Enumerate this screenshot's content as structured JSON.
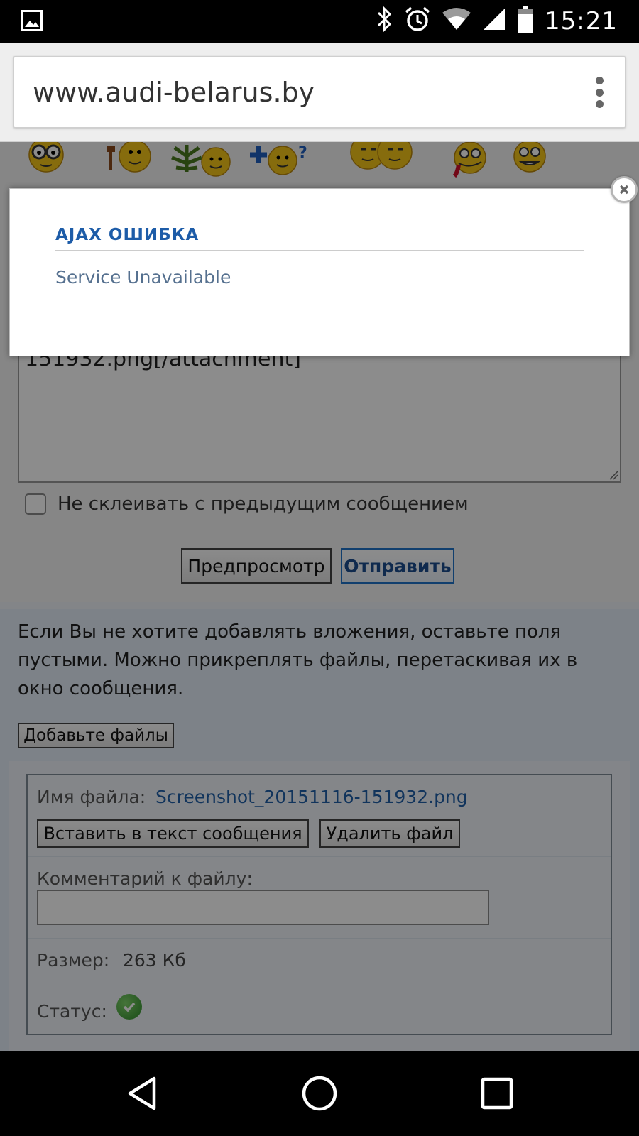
{
  "status_bar": {
    "time": "15:21",
    "icons": [
      "image-notification-icon",
      "bluetooth-icon",
      "alarm-icon",
      "wifi-icon",
      "cellular-signal-icon",
      "battery-icon"
    ]
  },
  "browser": {
    "url": "www.audi-belarus.by",
    "menu_icon": "overflow-menu-icon"
  },
  "editor": {
    "message_text": "151932.png[/attachment]",
    "no_merge_label": "Не склеивать с предыдущим сообщением",
    "no_merge_checked": false,
    "preview_button": "Предпросмотр",
    "submit_button": "Отправить"
  },
  "attachments": {
    "info_text": "Если Вы не хотите добавлять вложения, оставьте поля пустыми. Можно прикреплять файлы, перетаскивая их в окно сообщения.",
    "add_files_button": "Добавьте файлы",
    "file": {
      "name_label": "Имя файла:",
      "name_value": "Screenshot_20151116-151932.png",
      "insert_button": "Вставить в текст сообщения",
      "delete_button": "Удалить файл",
      "comment_label": "Комментарий к файлу:",
      "comment_value": "",
      "size_label": "Размер:",
      "size_value": "263 Кб",
      "status_label": "Статус:",
      "status_icon": "check-circle-icon"
    }
  },
  "dialog": {
    "title": "AJAX ОШИБКА",
    "message": "Service Unavailable",
    "close_icon": "close-icon"
  },
  "nav_bar": {
    "icons": [
      "back-icon",
      "home-icon",
      "recents-icon"
    ]
  },
  "colors": {
    "dialog_title": "#1d5ca8",
    "link": "#1f5fa8",
    "submit_border": "#1f73c9",
    "status_ok": "#2e8b2a"
  }
}
